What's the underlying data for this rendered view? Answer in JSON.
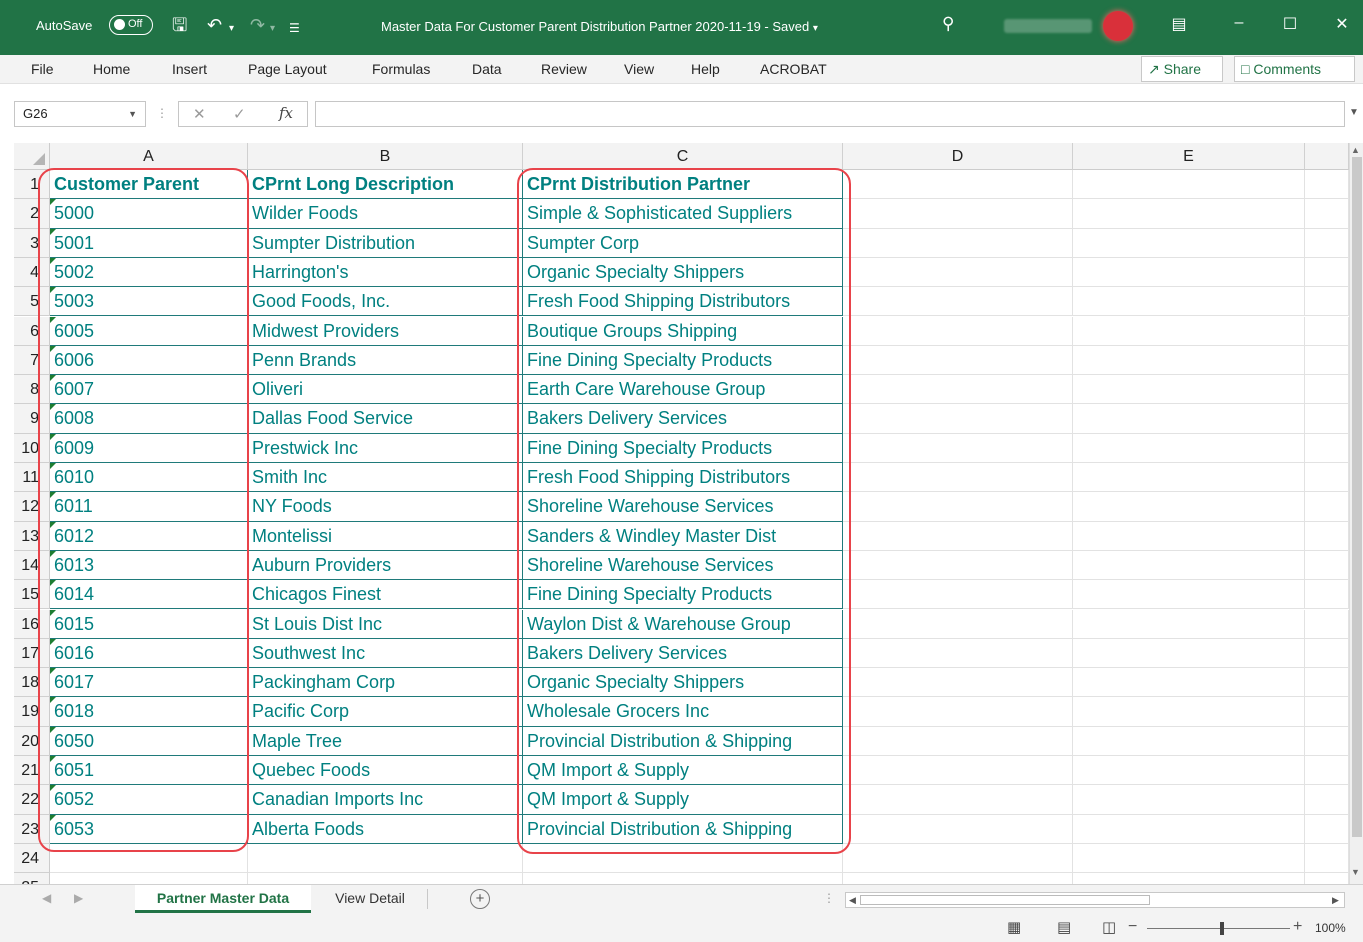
{
  "titlebar": {
    "autosave_label": "AutoSave",
    "autosave_state": "Off",
    "document_title": "Master Data For Customer Parent Distribution Partner 2020-11-19  -  Saved",
    "icons": [
      "save-icon",
      "undo-icon",
      "redo-icon",
      "customize-icon",
      "search-icon",
      "ribbon-display-icon",
      "minimize-icon",
      "maximize-icon",
      "close-icon"
    ],
    "accent": "#217346"
  },
  "menubar": {
    "items": [
      "File",
      "Home",
      "Insert",
      "Page Layout",
      "Formulas",
      "Data",
      "Review",
      "View",
      "Help",
      "ACROBAT"
    ],
    "share_label": "Share",
    "comments_label": "Comments"
  },
  "formula_bar": {
    "name_box": "G26",
    "fx_label": "fx",
    "formula_value": ""
  },
  "sheet": {
    "columns": [
      "A",
      "B",
      "C",
      "D",
      "E"
    ],
    "row_numbers": [
      "1",
      "2",
      "3",
      "4",
      "5",
      "6",
      "7",
      "8",
      "9",
      "10",
      "11",
      "12",
      "13",
      "14",
      "15",
      "16",
      "17",
      "18",
      "19",
      "20",
      "21",
      "22",
      "23",
      "24",
      "25"
    ],
    "header": [
      "Customer Parent",
      "CPrnt Long Description",
      "CPrnt Distribution Partner"
    ],
    "rows": [
      [
        "5000",
        "Wilder Foods",
        "Simple & Sophisticated Suppliers"
      ],
      [
        "5001",
        "Sumpter Distribution",
        "Sumpter Corp"
      ],
      [
        "5002",
        "Harrington's",
        "Organic Specialty Shippers"
      ],
      [
        "5003",
        "Good Foods, Inc.",
        "Fresh Food Shipping Distributors"
      ],
      [
        "6005",
        "Midwest Providers",
        "Boutique Groups Shipping"
      ],
      [
        "6006",
        "Penn Brands",
        "Fine Dining Specialty Products"
      ],
      [
        "6007",
        "Oliveri",
        "Earth Care Warehouse Group"
      ],
      [
        "6008",
        "Dallas Food Service",
        "Bakers Delivery Services"
      ],
      [
        "6009",
        "Prestwick Inc",
        "Fine Dining Specialty Products"
      ],
      [
        "6010",
        "Smith Inc",
        "Fresh Food Shipping Distributors"
      ],
      [
        "6011",
        "NY Foods",
        "Shoreline Warehouse Services"
      ],
      [
        "6012",
        "Montelissi",
        "Sanders & Windley Master Dist"
      ],
      [
        "6013",
        "Auburn Providers",
        "Shoreline Warehouse Services"
      ],
      [
        "6014",
        "Chicagos Finest",
        "Fine Dining Specialty Products"
      ],
      [
        "6015",
        "St Louis Dist Inc",
        "Waylon Dist & Warehouse Group"
      ],
      [
        "6016",
        "Southwest Inc",
        "Bakers Delivery Services"
      ],
      [
        "6017",
        "Packingham Corp",
        "Organic Specialty Shippers"
      ],
      [
        "6018",
        "Pacific Corp",
        "Wholesale Grocers Inc"
      ],
      [
        "6050",
        "Maple Tree",
        "Provincial Distribution & Shipping"
      ],
      [
        "6051",
        "Quebec Foods",
        "QM Import & Supply"
      ],
      [
        "6052",
        "Canadian Imports Inc",
        "QM Import & Supply"
      ],
      [
        "6053",
        "Alberta Foods",
        "Provincial Distribution & Shipping"
      ]
    ],
    "text_color": "#008080",
    "highlight_color": "#e8434a"
  },
  "tabs": {
    "sheets": [
      "Partner Master Data",
      "View Detail"
    ],
    "active": "Partner Master Data",
    "add_label": "+"
  },
  "statusbar": {
    "zoom_label": "100%",
    "zoom_minus": "−",
    "zoom_plus": "+",
    "zoom_percent": 100
  }
}
